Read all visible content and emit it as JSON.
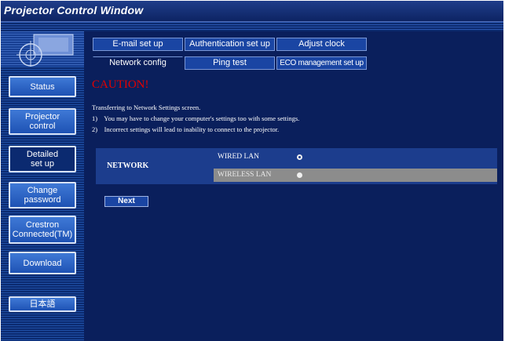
{
  "window": {
    "title": "Projector Control Window"
  },
  "sidebar": {
    "items": [
      {
        "label": "Status"
      },
      {
        "label": "Projector\ncontrol"
      },
      {
        "label": "Detailed\nset up"
      },
      {
        "label": "Change\npassword"
      },
      {
        "label": "Crestron\nConnected(TM)"
      },
      {
        "label": "Download"
      },
      {
        "label": "日本語"
      }
    ],
    "active": "Detailed set up"
  },
  "tabs": {
    "row1": [
      "E-mail set up",
      "Authentication set up",
      "Adjust clock"
    ],
    "row2": [
      "Network config",
      "Ping test",
      "ECO management set up"
    ],
    "active": "Network config"
  },
  "content": {
    "caution": "CAUTION!",
    "messages": [
      "Transferring to Network Settings screen.",
      "1)    You may have to change your computer's settings too with some settings.",
      "2)    Incorrect settings will lead to inability to connect to the projector."
    ],
    "network": {
      "label": "NETWORK",
      "options": [
        {
          "label": "WIRED LAN",
          "selected": true,
          "enabled": true
        },
        {
          "label": "WIRELESS LAN",
          "selected": false,
          "enabled": false
        }
      ]
    },
    "next_label": "Next"
  },
  "colors": {
    "background": "#0a1f5c",
    "caution": "#e30000",
    "tab": "#1a45a3",
    "disabled_row": "#8c8c8c"
  }
}
